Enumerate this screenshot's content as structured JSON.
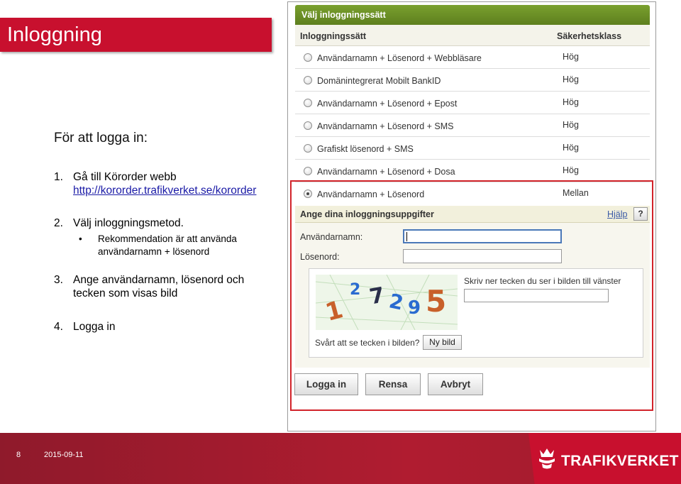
{
  "slide": {
    "title": "Inloggning",
    "intro": "För att logga in:",
    "steps": [
      {
        "num": "1.",
        "line1": "Gå till Körorder webb",
        "link": "http://kororder.trafikverket.se/kororder"
      },
      {
        "num": "2.",
        "line1": "Välj inloggningsmetod."
      },
      {
        "num": "3.",
        "line1": "Ange användarnamn, lösenord och",
        "line2": "tecken som visas bild"
      },
      {
        "num": "4.",
        "line1": "Logga in"
      }
    ],
    "bullet": {
      "symbol": "•",
      "line1": "Rekommendation är att använda",
      "line2": "användarnamn + lösenord"
    }
  },
  "login_form": {
    "header": "Välj inloggningssätt",
    "col_method": "Inloggningssätt",
    "col_security": "Säkerhetsklass",
    "methods": [
      {
        "label": "Användarnamn + Lösenord + Webbläsare",
        "security": "Hög",
        "selected": false
      },
      {
        "label": "Domänintegrerat Mobilt BankID",
        "security": "Hög",
        "selected": false
      },
      {
        "label": "Användarnamn + Lösenord + Epost",
        "security": "Hög",
        "selected": false
      },
      {
        "label": "Användarnamn + Lösenord + SMS",
        "security": "Hög",
        "selected": false
      },
      {
        "label": "Grafiskt lösenord + SMS",
        "security": "Hög",
        "selected": false
      },
      {
        "label": "Användarnamn + Lösenord + Dosa",
        "security": "Hög",
        "selected": false
      },
      {
        "label": "Användarnamn + Lösenord",
        "security": "Mellan",
        "selected": true
      }
    ],
    "credentials_header": "Ange dina inloggningsuppgifter",
    "help_link": "Hjälp",
    "help_button": "?",
    "username_label": "Användarnamn:",
    "password_label": "Lösenord:",
    "username_value": "",
    "password_value": "",
    "captcha_hint": "Skriv ner tecken du ser i bilden till vänster",
    "captcha_chars": "1 2 7 2 9 5",
    "captcha_question": "Svårt att se tecken i bilden?",
    "new_image_button": "Ny bild",
    "login_button": "Logga in",
    "clear_button": "Rensa",
    "cancel_button": "Avbryt"
  },
  "footer": {
    "page_number": "8",
    "date": "2015-09-11",
    "brand": "TRAFIKVERKET",
    "colors": {
      "brand_red": "#c8102e",
      "dark_red": "#8f1a2b",
      "selection_red": "#d2232a",
      "header_green": "#6b8f24"
    }
  }
}
